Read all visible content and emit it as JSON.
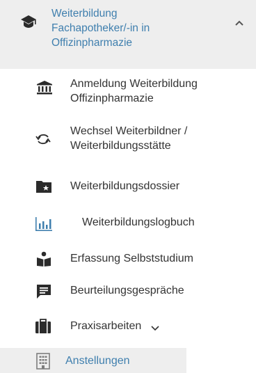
{
  "section": {
    "title_lines": [
      "Weiterbildung",
      "Fachapotheker/-in in",
      "Offizinpharmazie"
    ],
    "icon": "graduation-cap-icon",
    "toggle_icon": "chevron-up-icon"
  },
  "items": [
    {
      "lines": [
        "Anmeldung Weiterbildung",
        "Offizinpharmazie"
      ],
      "icon": "institution-icon"
    },
    {
      "lines": [
        "Wechsel Weiterbildner /",
        "Weiterbildungsstätte"
      ],
      "icon": "sync-icon"
    },
    {
      "lines": [
        "Weiterbildungsdossier"
      ],
      "icon": "folder-star-icon"
    },
    {
      "lines": [
        "Weiterbildungslogbuch"
      ],
      "icon": "bar-chart-icon"
    },
    {
      "lines": [
        "Erfassung Selbststudium"
      ],
      "icon": "person-reading-icon"
    },
    {
      "lines": [
        "Beurteilungsgespräche"
      ],
      "icon": "comment-icon"
    },
    {
      "lines": [
        "Praxisarbeiten"
      ],
      "icon": "briefcase-icon",
      "dropdown_icon": "chevron-down-icon"
    },
    {
      "lines": [
        "Anstellungen"
      ],
      "icon": "building-icon"
    }
  ],
  "colors": {
    "accent": "#3f7fae",
    "text": "#333333",
    "icon": "#2b2b2b",
    "highlight_bg": "#eeeeee"
  }
}
